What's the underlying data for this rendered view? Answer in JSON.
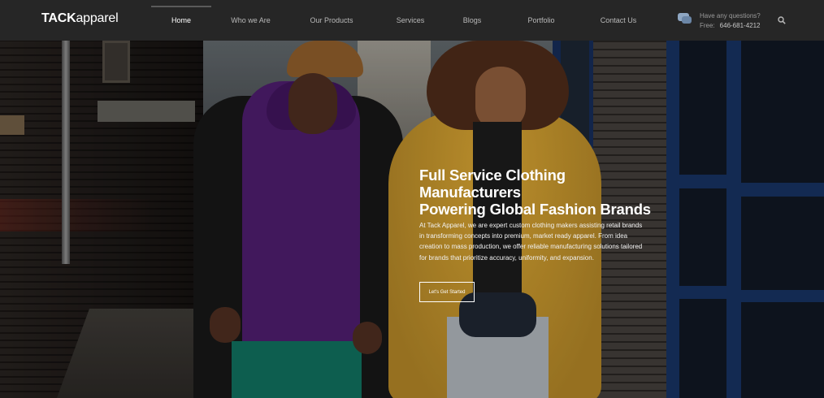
{
  "brand": {
    "logo_bold": "TACK",
    "logo_thin": "apparel"
  },
  "nav": {
    "items": [
      {
        "label": "Home",
        "active": true
      },
      {
        "label": "Who we Are",
        "active": false
      },
      {
        "label": "Our Products",
        "active": false
      },
      {
        "label": "Services",
        "active": false
      },
      {
        "label": "Blogs",
        "active": false
      },
      {
        "label": "Portfolio",
        "active": false
      },
      {
        "label": "Contact Us",
        "active": false
      }
    ]
  },
  "contact": {
    "question": "Have any questions?",
    "free_label": "Free:",
    "phone": "646-681-4212",
    "icon": "chat-bubbles-icon"
  },
  "search": {
    "icon": "search-icon"
  },
  "hero": {
    "headline": [
      "Full Service Clothing",
      "Manufacturers",
      "Powering Global Fashion Brands"
    ],
    "body": "At Tack Apparel, we are expert custom clothing makers assisting retail brands in transforming concepts into premium, market ready apparel. From idea creation to mass production, we offer reliable manufacturing solutions tailored for brands that prioritize accuracy, uniformity, and expansion.",
    "cta_label": "Let's Get Started"
  },
  "colors": {
    "nav_bg": "#262626",
    "nav_text": "#b9b9b9",
    "nav_active": "#ffffff",
    "hero_text": "#ffffff"
  }
}
